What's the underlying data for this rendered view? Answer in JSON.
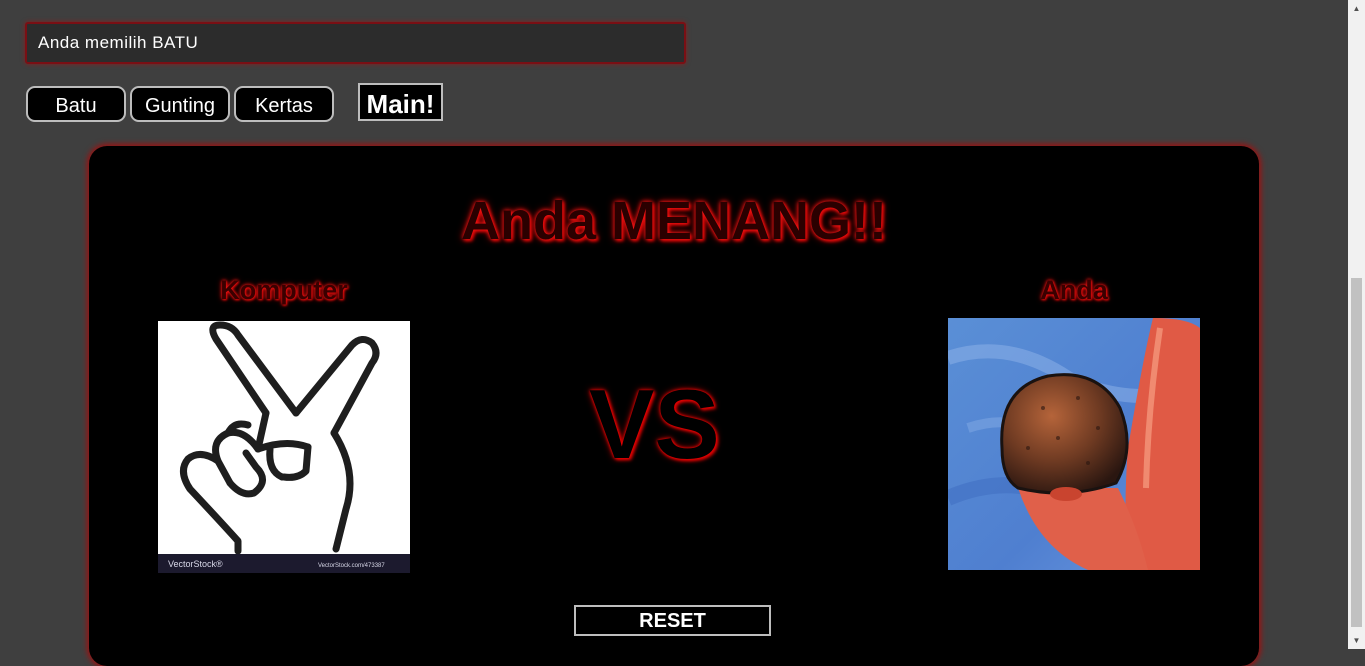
{
  "status": {
    "message": "Anda memilih BATU"
  },
  "choices": [
    {
      "label": "Batu"
    },
    {
      "label": "Gunting"
    },
    {
      "label": "Kertas"
    }
  ],
  "play_button": {
    "label": "Main!"
  },
  "arena": {
    "result": "Anda MENANG!!",
    "computer_label": "Komputer",
    "user_label": "Anda",
    "vs": "VS",
    "computer_image": {
      "icon": "peace-hand-gunting",
      "watermark_left": "VectorStock®",
      "watermark_right": "VectorStock.com/473387"
    },
    "user_image": {
      "icon": "rock-batu-painting"
    },
    "reset_label": "RESET"
  },
  "colors": {
    "background": "#3f3f3f",
    "accent_red": "#c00000",
    "panel": "#000000"
  }
}
